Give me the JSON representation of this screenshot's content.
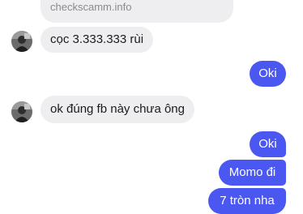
{
  "messages": {
    "link_preview": "checkscamm.info",
    "incoming_1": "cọc 3.333.333 rùi",
    "outgoing_1": "Oki",
    "incoming_2": "ok đúng fb này chưa ông",
    "outgoing_2": "Oki",
    "outgoing_3": "Momo đi",
    "outgoing_4": "7 tròn nha"
  },
  "colors": {
    "outgoing_bubble": "#4a57f0",
    "incoming_bubble": "#eeeef0"
  },
  "icons": {
    "avatar": "contact-avatar"
  }
}
